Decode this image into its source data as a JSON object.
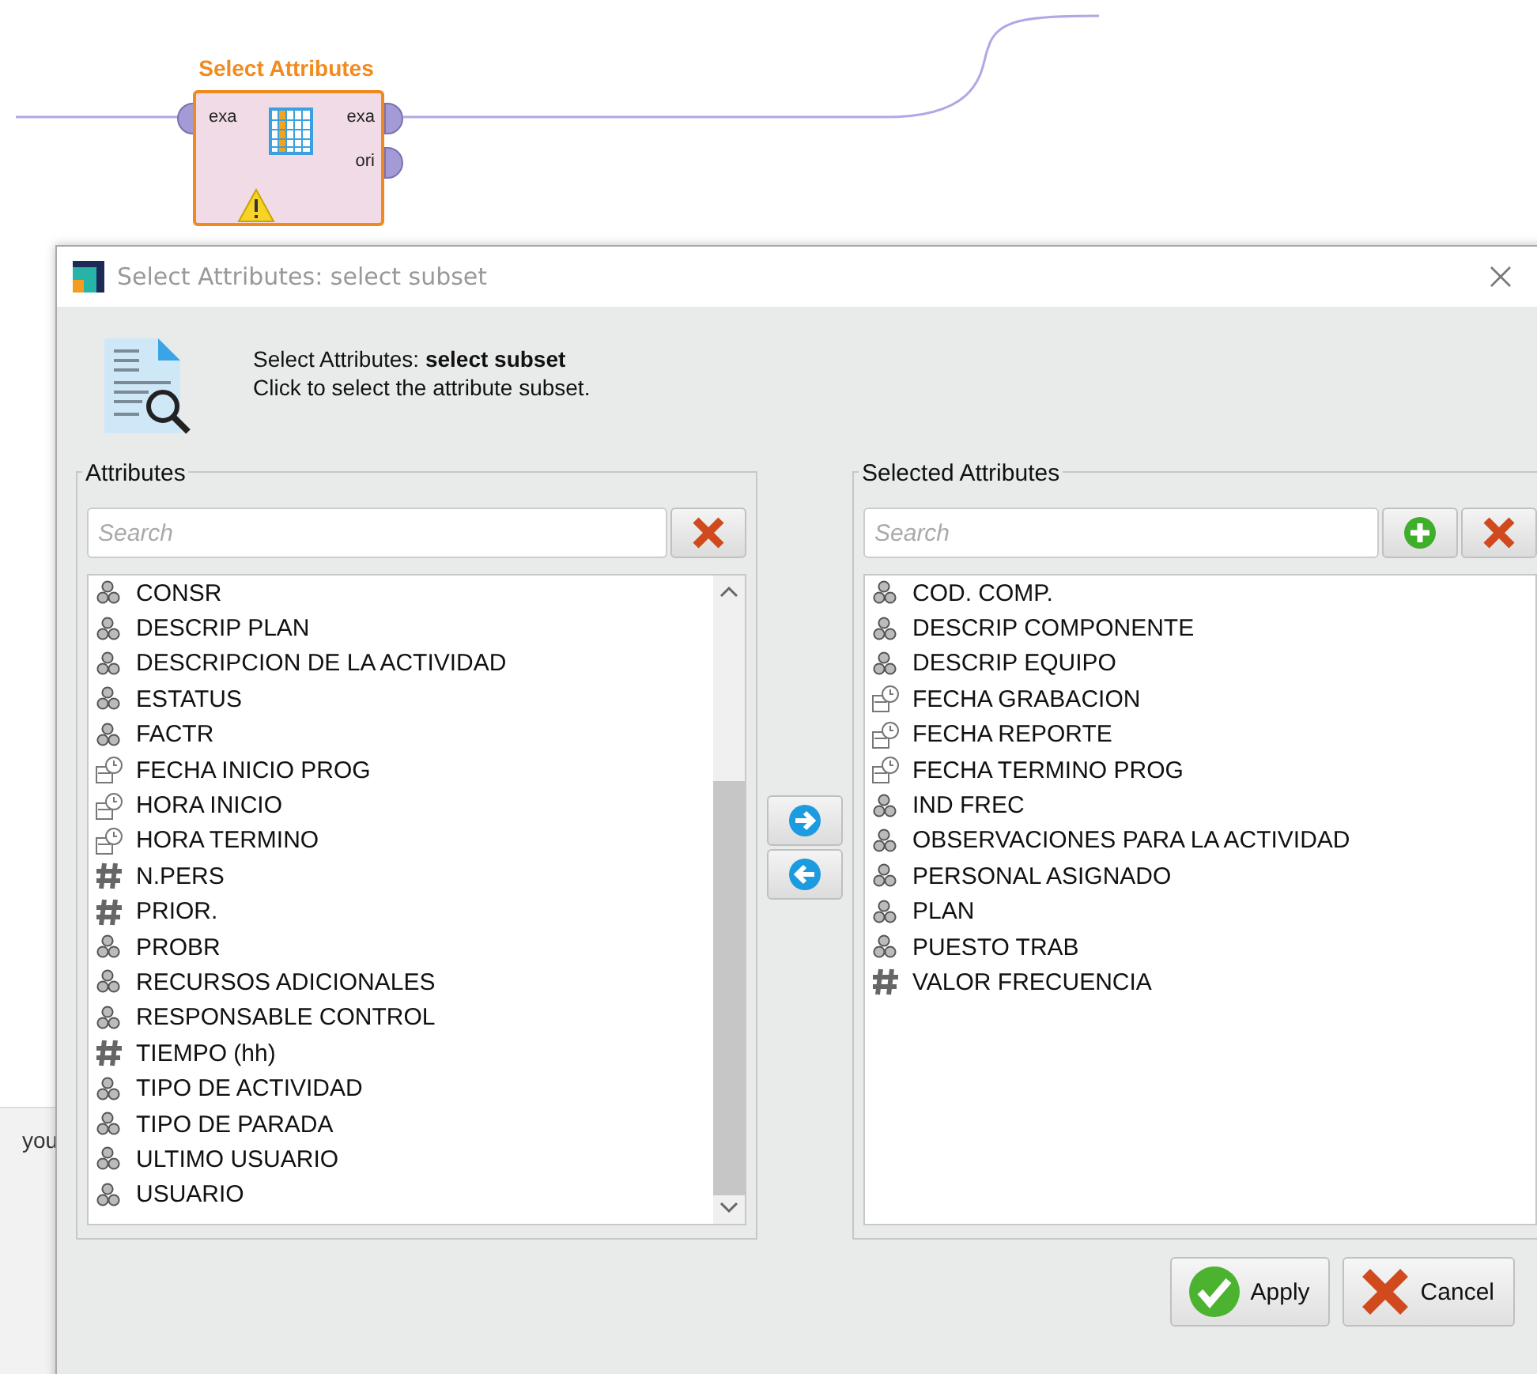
{
  "canvas": {
    "operator": {
      "title": "Select Attributes",
      "input_ports": [
        "exa"
      ],
      "output_ports": [
        "exa",
        "ori"
      ],
      "warning": true
    }
  },
  "background_panel": {
    "text": "you"
  },
  "dialog": {
    "title": "Select Attributes: select subset",
    "heading": "Select Attributes: **select subset**",
    "description": "Click to select the attribute subset.",
    "attributes": {
      "label": "Attributes",
      "search": {
        "placeholder": "Search"
      },
      "items": [
        {
          "name": "CONSR",
          "kind": "nominal"
        },
        {
          "name": "DESCRIP PLAN",
          "kind": "nominal"
        },
        {
          "name": "DESCRIPCION DE LA ACTIVIDAD",
          "kind": "nominal"
        },
        {
          "name": "ESTATUS",
          "kind": "nominal"
        },
        {
          "name": "FACTR",
          "kind": "nominal"
        },
        {
          "name": "FECHA INICIO PROG",
          "kind": "date"
        },
        {
          "name": "HORA INICIO",
          "kind": "date"
        },
        {
          "name": "HORA TERMINO",
          "kind": "date"
        },
        {
          "name": "N.PERS",
          "kind": "numeric"
        },
        {
          "name": "PRIOR.",
          "kind": "numeric"
        },
        {
          "name": "PROBR",
          "kind": "nominal"
        },
        {
          "name": "RECURSOS ADICIONALES",
          "kind": "nominal"
        },
        {
          "name": "RESPONSABLE CONTROL",
          "kind": "nominal"
        },
        {
          "name": "TIEMPO (hh)",
          "kind": "numeric"
        },
        {
          "name": "TIPO DE ACTIVIDAD",
          "kind": "nominal"
        },
        {
          "name": "TIPO DE PARADA",
          "kind": "nominal"
        },
        {
          "name": "ULTIMO USUARIO",
          "kind": "nominal"
        },
        {
          "name": "USUARIO",
          "kind": "nominal"
        }
      ]
    },
    "selected_attributes": {
      "label": "Selected Attributes",
      "search": {
        "placeholder": "Search"
      },
      "items": [
        {
          "name": "COD. COMP.",
          "kind": "nominal"
        },
        {
          "name": "DESCRIP COMPONENTE",
          "kind": "nominal"
        },
        {
          "name": "DESCRIP EQUIPO",
          "kind": "nominal"
        },
        {
          "name": "FECHA GRABACION",
          "kind": "date"
        },
        {
          "name": "FECHA REPORTE",
          "kind": "date"
        },
        {
          "name": "FECHA TERMINO PROG",
          "kind": "date"
        },
        {
          "name": "IND FREC",
          "kind": "nominal"
        },
        {
          "name": "OBSERVACIONES PARA LA ACTIVIDAD",
          "kind": "nominal"
        },
        {
          "name": "PERSONAL ASIGNADO",
          "kind": "nominal"
        },
        {
          "name": "PLAN",
          "kind": "nominal"
        },
        {
          "name": "PUESTO TRAB",
          "kind": "nominal"
        },
        {
          "name": "VALOR FRECUENCIA",
          "kind": "numeric"
        }
      ]
    },
    "buttons": [
      {
        "label": "Apply",
        "kind": "apply"
      },
      {
        "label": "Cancel",
        "kind": "cancel"
      }
    ]
  }
}
